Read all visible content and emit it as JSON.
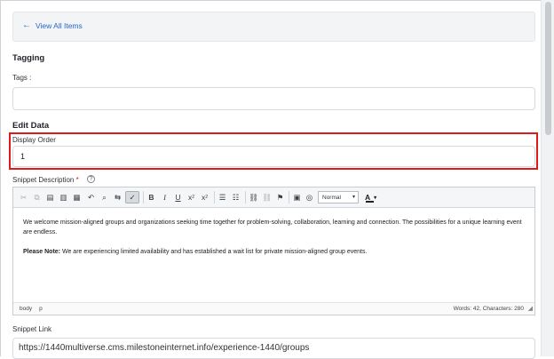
{
  "back_bar": {
    "label": "View All Items"
  },
  "tagging": {
    "section_title": "Tagging",
    "tags_label": "Tags :",
    "tags_value": ""
  },
  "edit_data": {
    "section_title": "Edit Data",
    "display_order_label": "Display Order",
    "display_order_value": "1",
    "snippet_description_label": "Snippet Description",
    "required_mark": "*",
    "help_icon": "?"
  },
  "editor": {
    "toolbar": {
      "icons": [
        "cut-icon",
        "copy-icon",
        "paste-icon",
        "paste-text-icon",
        "paste-word-icon",
        "undo-icon",
        "find-icon",
        "replace-icon",
        "spellcheck-icon",
        "bold-icon",
        "italic-icon",
        "underline-icon",
        "subscript-icon",
        "superscript-icon",
        "numbered-list-icon",
        "bulleted-list-icon",
        "link-icon",
        "unlink-icon",
        "anchor-icon",
        "image-icon",
        "source-icon"
      ],
      "bold": "B",
      "italic": "I",
      "underline": "U",
      "format_value": "Normal",
      "text_color": "A"
    },
    "paragraph1": "We welcome mission-aligned groups and organizations seeking time together for problem-solving, collaboration, learning and connection. The possibilities for a unique learning event are endless.",
    "note_label": "Please Note:",
    "note_text": " We are experiencing limited availability and has established a wait list for private mission-aligned group events.",
    "path": [
      "body",
      "p"
    ],
    "counts": "Words: 42, Characters: 280"
  },
  "snippet_link": {
    "label": "Snippet Link",
    "value": "https://1440multiverse.cms.milestoneinternet.info/experience-1440/groups"
  },
  "colors": {
    "link": "#2a64c9",
    "highlight": "#e01919",
    "required": "#dd1111"
  }
}
